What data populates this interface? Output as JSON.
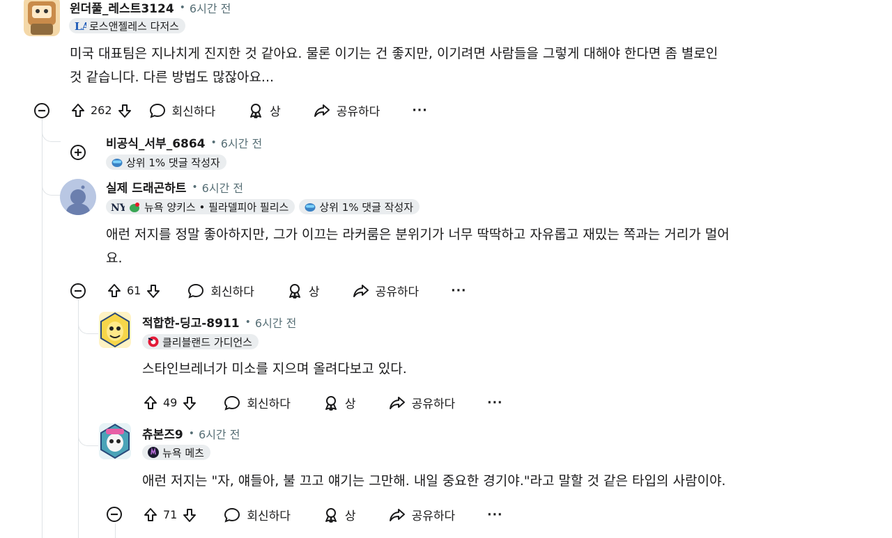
{
  "comments": [
    {
      "username": "윈더풀_레스트3124",
      "time": "6시간 전",
      "flairs": [
        "로스앤젤레스 다저스"
      ],
      "text_lines": [
        "미국 대표팀은 지나치게 진지한 것 같아요. 물론 이기는 건 좋지만, 이기려면 사람들을 그렇게 대해야 한다면 좀 별로인",
        "것 같습니다. 다른 방법도 많잖아요..."
      ],
      "votes": "262"
    },
    {
      "username": "비공식_서부_6864",
      "time": "6시간 전",
      "flairs": [
        "상위 1% 댓글 작성자"
      ],
      "collapsed": true
    },
    {
      "username": "실제 드래곤하트",
      "time": "6시간 전",
      "flairs": [
        "뉴욕 양키스 • 필라델피아 필리스",
        "상위 1% 댓글 작성자"
      ],
      "text_lines": [
        "애런 저지를 정말 좋아하지만, 그가 이끄는 라커룸은 분위기가 너무 딱딱하고 자유롭고 재밌는 쪽과는 거리가 멀어",
        "요."
      ],
      "votes": "61"
    },
    {
      "username": "적합한-딩고-8911",
      "time": "6시간 전",
      "flairs": [
        "클리블랜드 가디언스"
      ],
      "text_lines": [
        "스타인브레너가 미소를 지으며 올려다보고 있다."
      ],
      "votes": "49"
    },
    {
      "username": "츄본즈9",
      "time": "6시간 전",
      "flairs": [
        "뉴욕 메츠"
      ],
      "text_lines": [
        "애런 저지는 \"자, 얘들아, 불 끄고 얘기는 그만해. 내일 중요한 경기야.\"라고 말할 것 같은 타입의 사람이야."
      ],
      "votes": "71"
    }
  ],
  "actions": {
    "reply": "회신하다",
    "award": "상",
    "share": "공유하다",
    "more": "···"
  },
  "colors": {
    "text": "#1a1a1b",
    "meta": "#576f76",
    "flair_bg": "#eaedef",
    "thread_line": "#dfe3e6"
  },
  "icons": [
    "upvote-icon",
    "downvote-icon",
    "comment-icon",
    "award-icon",
    "share-icon",
    "more-icon",
    "collapse-icon",
    "expand-icon"
  ]
}
